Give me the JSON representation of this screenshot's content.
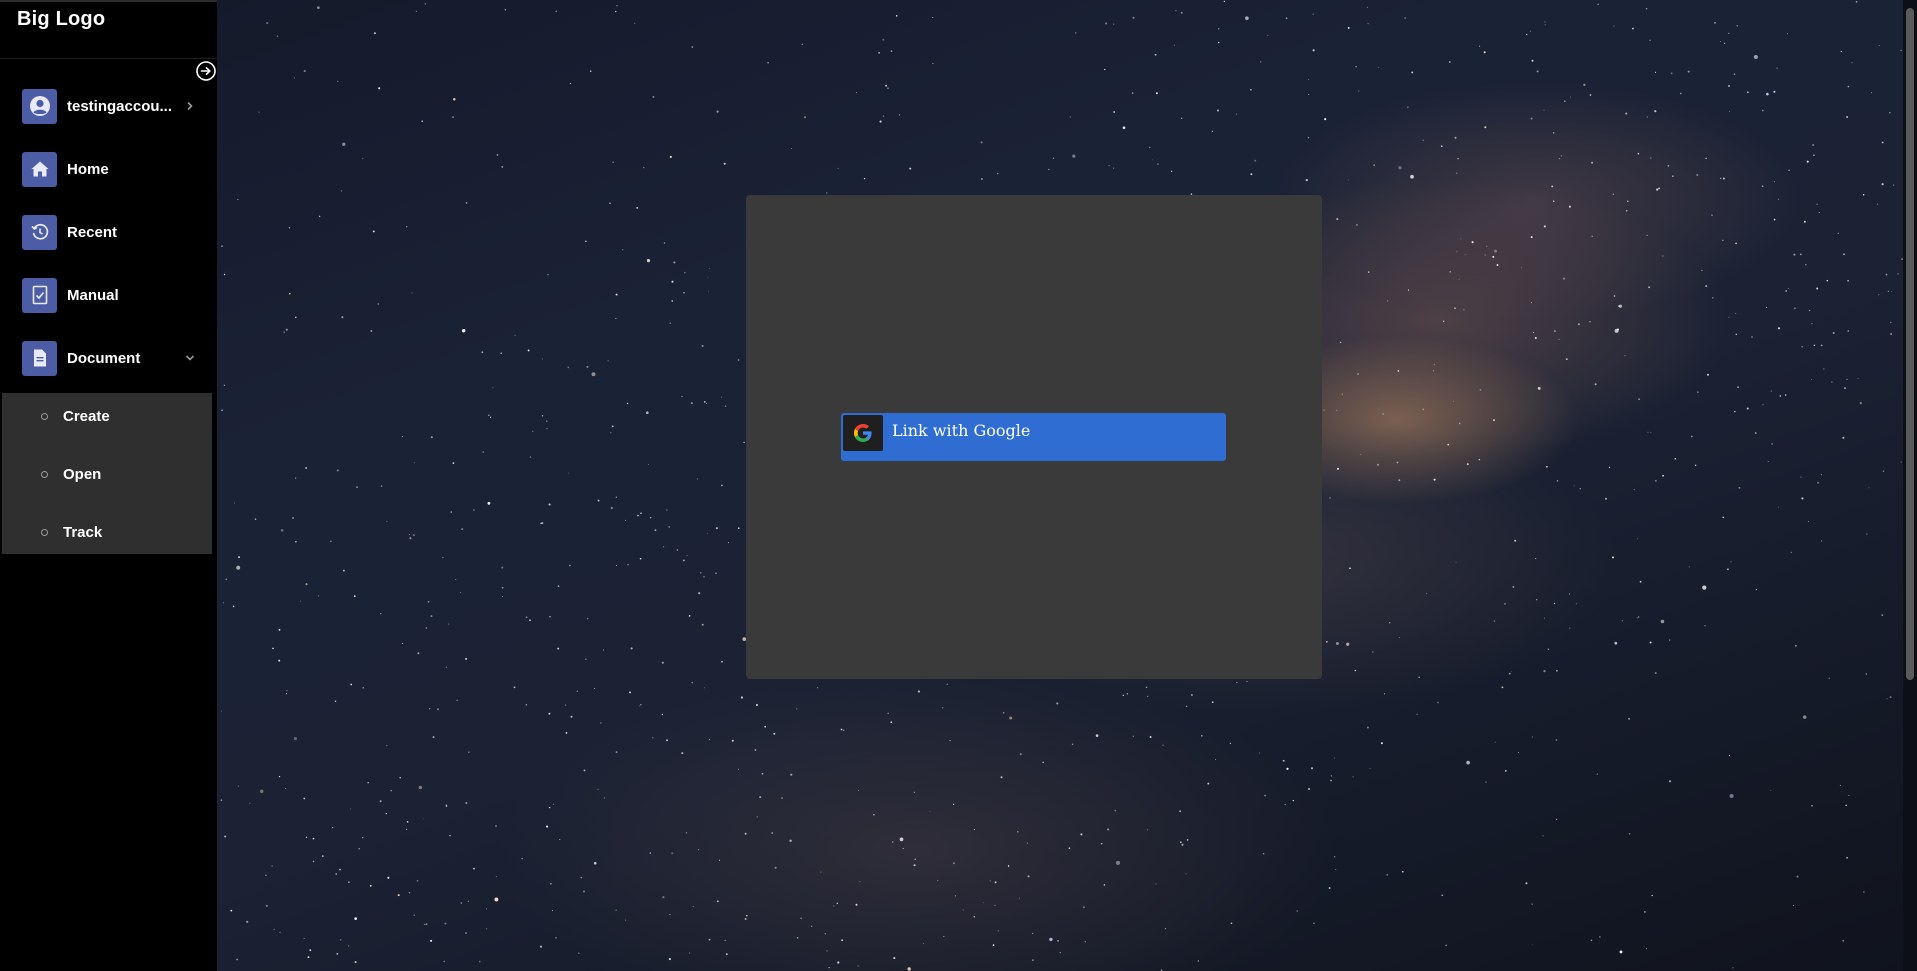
{
  "app": {
    "logo": "Big Logo"
  },
  "sidebar": {
    "account": {
      "label": "testingaccou...",
      "icon": "user-circle-icon"
    },
    "items": [
      {
        "label": "Home",
        "icon": "home-icon"
      },
      {
        "label": "Recent",
        "icon": "history-icon"
      },
      {
        "label": "Manual",
        "icon": "checklist-document-icon"
      },
      {
        "label": "Document",
        "icon": "document-icon",
        "expanded": true
      }
    ],
    "submenu": [
      {
        "label": "Create"
      },
      {
        "label": "Open"
      },
      {
        "label": "Track"
      }
    ],
    "accent_color": "#4c5da6"
  },
  "main": {
    "google_button": {
      "label": "Link with Google",
      "icon": "google-g-icon",
      "color": "#2f6dd3"
    }
  }
}
